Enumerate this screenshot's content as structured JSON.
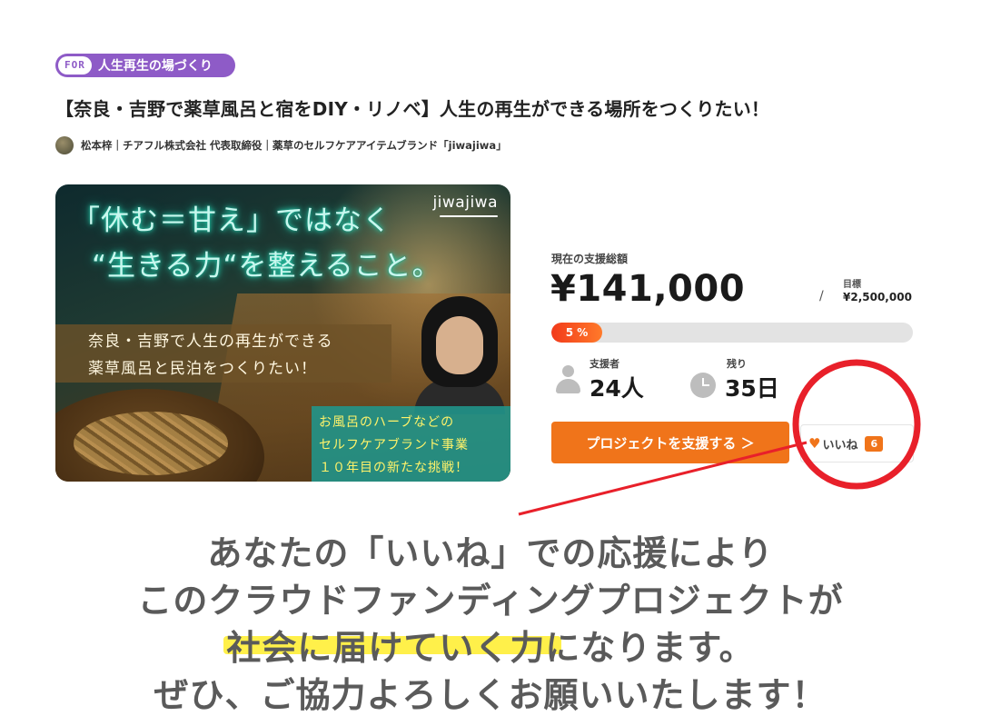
{
  "tag": {
    "prefix": "FOR",
    "label": "人生再生の場づくり"
  },
  "project": {
    "title": "【奈良・吉野で薬草風呂と宿をDIY・リノベ】人生の再生ができる場所をつくりたい！",
    "author_line": "松本梓｜チアフル株式会社 代表取締役｜薬草のセルフケアアイテムブランド「jiwajiwa」"
  },
  "hero": {
    "logo": "jiwajiwa",
    "headline_1": "「休む＝甘え」ではなく",
    "headline_2": "“生きる力“を整えること。",
    "band_1": "奈良・吉野で人生の再生ができる",
    "band_2": "薬草風呂と民泊をつくりたい！",
    "note_1": "お風呂のハーブなどの",
    "note_2": "セルフケアブランド事業",
    "note_3": "１０年目の新たな挑戦！"
  },
  "funding": {
    "total_label": "現在の支援総額",
    "amount": "¥141,000",
    "goal_label": "目標",
    "goal_slash": "/",
    "goal_value": "¥2,500,000",
    "progress_percent": 5,
    "progress_label": "5 %",
    "supporters_label": "支援者",
    "supporters_value": "24人",
    "remaining_label": "残り",
    "remaining_value": "35日"
  },
  "actions": {
    "support_label": "プロジェクトを支援する ＞",
    "like_label": "いいね",
    "like_count": "6"
  },
  "caption": {
    "line_1": "あなたの「いいね」での応援により",
    "line_2": "このクラウドファンディングプロジェクトが",
    "line_3": "社会に届けていく力になります。",
    "line_4": "ぜひ、ご協力よろしくお願いいたします！"
  },
  "colors": {
    "tag": "#8e5bc7",
    "accent": "#f0741a",
    "annotation": "#e8202a",
    "highlight": "#fff04a"
  }
}
